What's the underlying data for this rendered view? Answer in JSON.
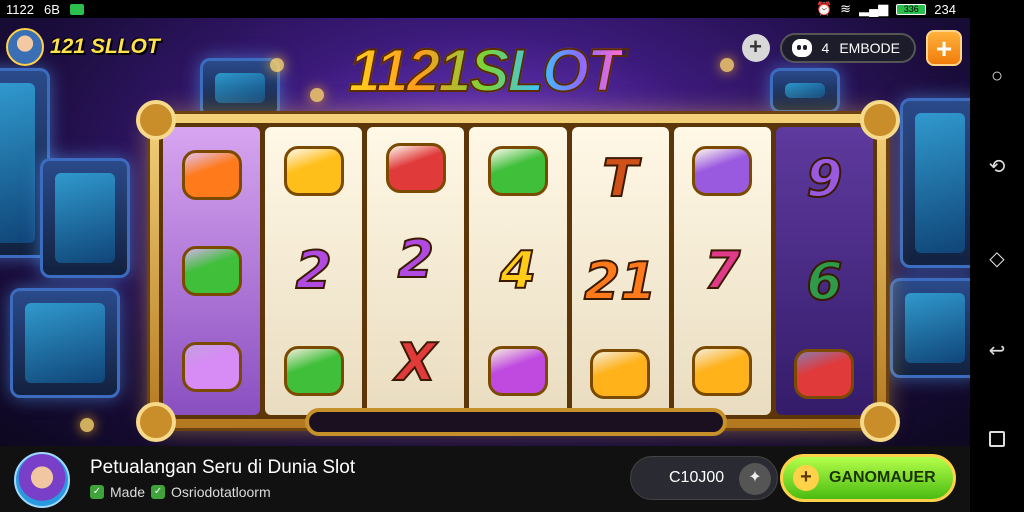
{
  "status_bar": {
    "time": "1122",
    "left_extra": "6B",
    "battery": "336",
    "right_extra": "234"
  },
  "header": {
    "brand": "121 SLLOT",
    "code_count": "4",
    "code_label": "EMBODE",
    "title": "1121SLOT"
  },
  "reels": [
    [
      "",
      "",
      ""
    ],
    [
      "",
      "2",
      ""
    ],
    [
      "",
      "2",
      "X"
    ],
    [
      "",
      "4",
      ""
    ],
    [
      "T",
      "21",
      ""
    ],
    [
      "",
      "7",
      ""
    ],
    [
      "9",
      "6",
      ""
    ]
  ],
  "footer": {
    "title": "Petualangan Seru di Dunia Slot",
    "sub_prefix": "Made",
    "sub_source": "Osriodotatloorm",
    "balance": "C10J00",
    "cta_label": "GANOMAUER"
  },
  "icons": {
    "home": "circle-icon",
    "rotate": "rotate-icon",
    "assistant": "diamond-icon",
    "back": "back-icon",
    "recents": "square-icon"
  }
}
